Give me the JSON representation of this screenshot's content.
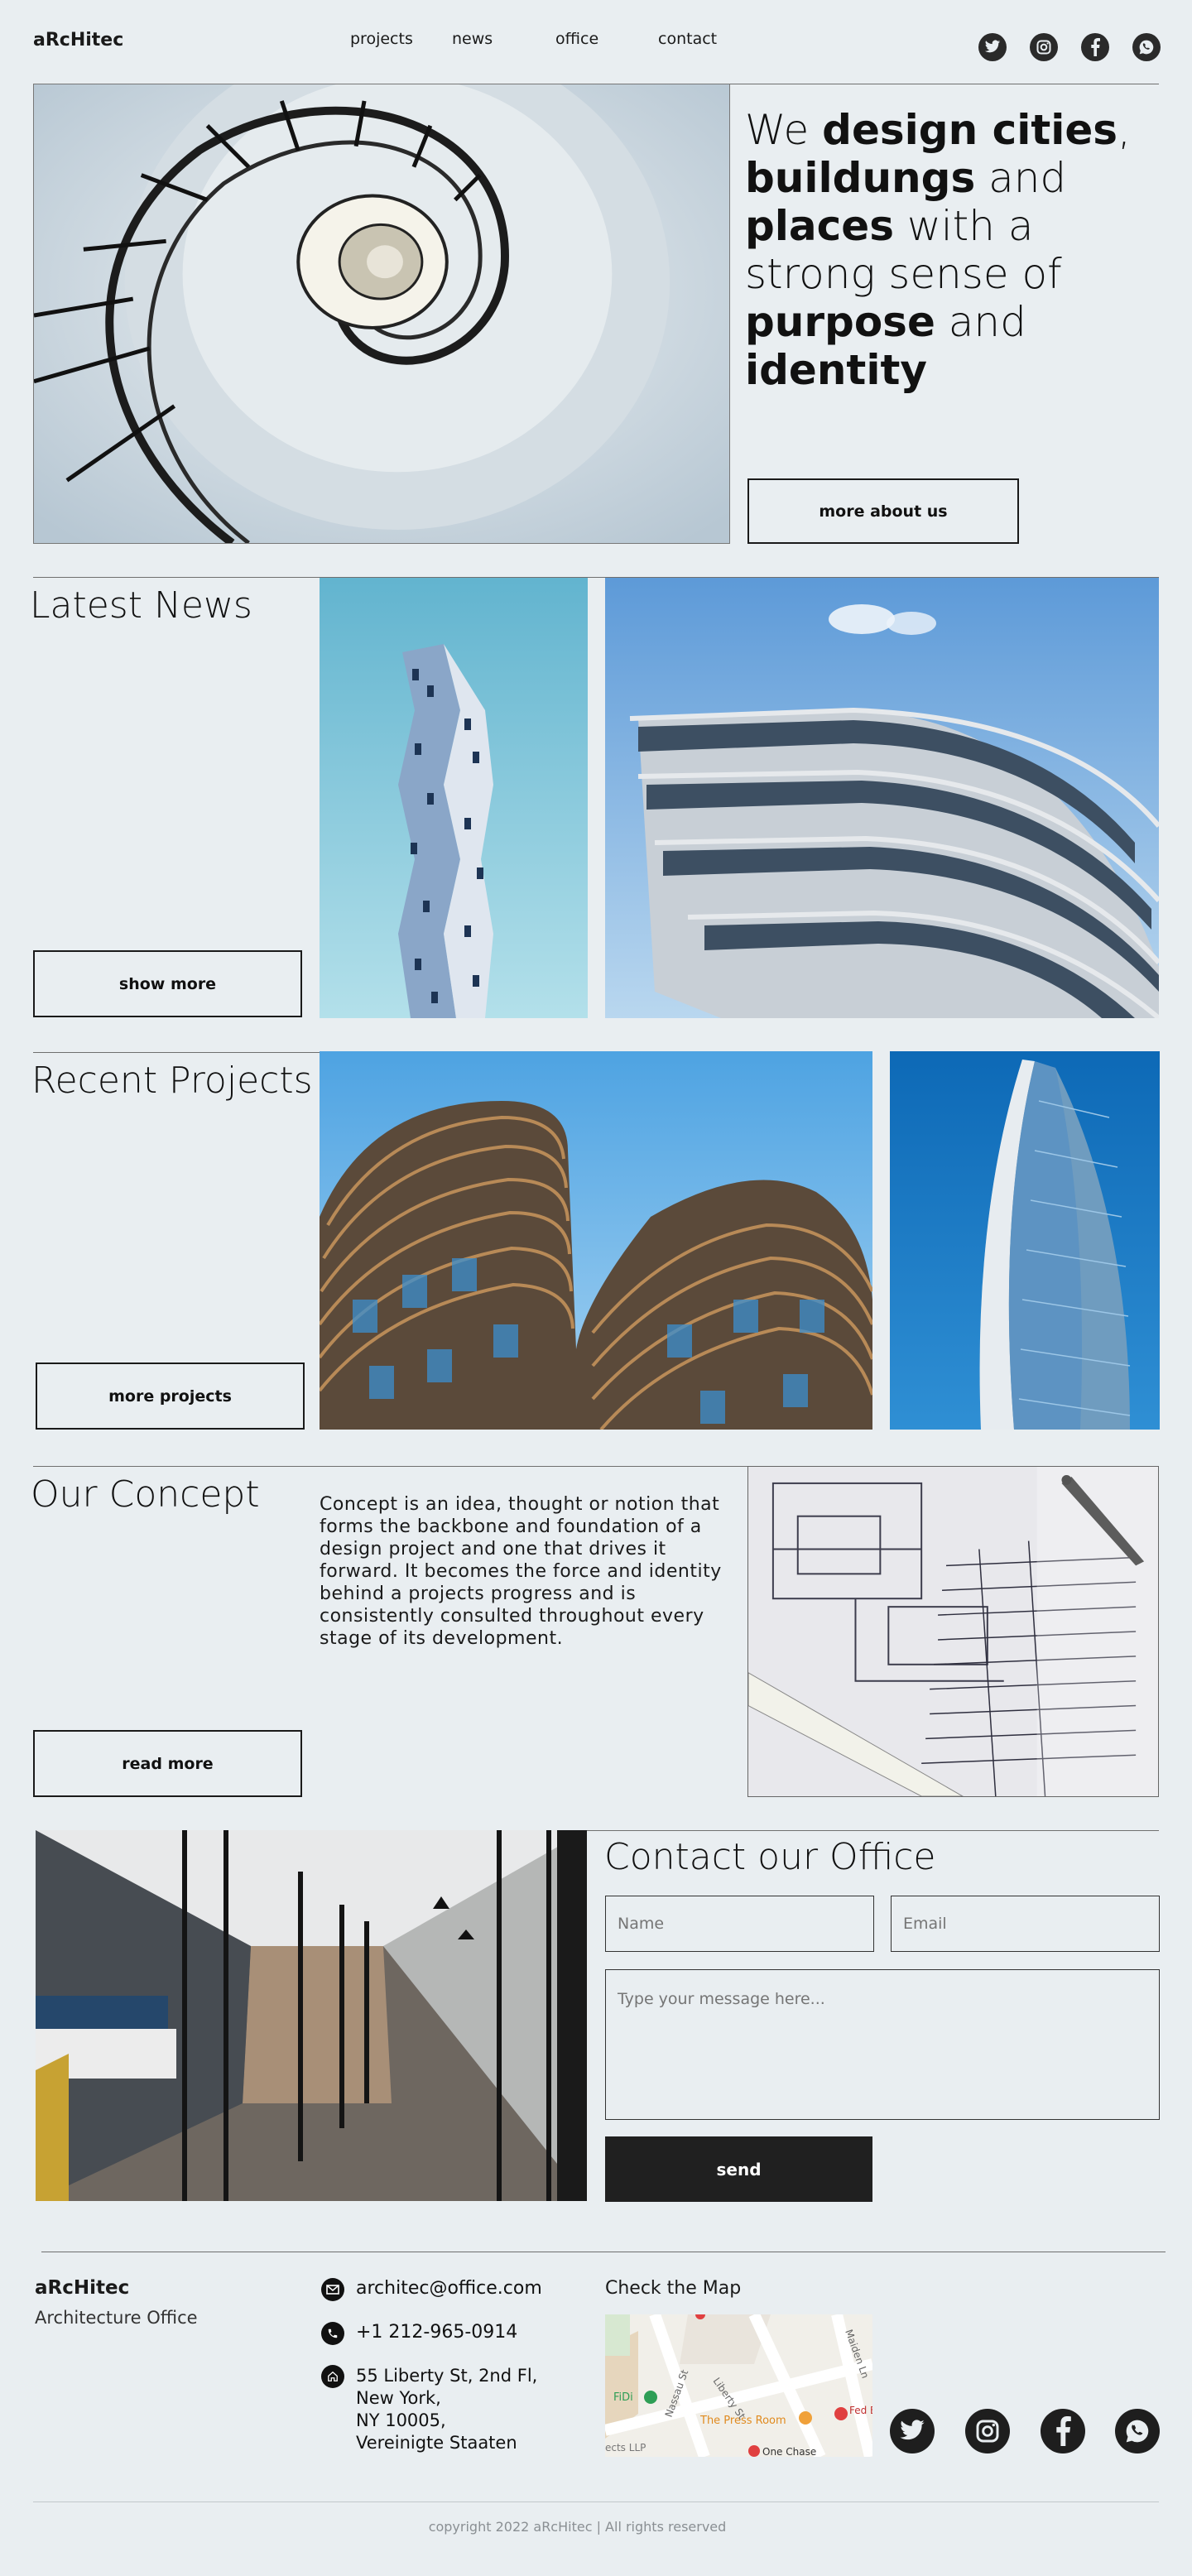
{
  "brand": {
    "logo": "aRcHitec"
  },
  "nav": {
    "items": [
      "projects",
      "news",
      "office",
      "contact"
    ]
  },
  "social": {
    "icons": [
      "twitter-icon",
      "instagram-icon",
      "facebook-icon",
      "whatsapp-icon"
    ]
  },
  "hero": {
    "p1": "We ",
    "b1": "design cities",
    "p2": ", ",
    "b2": "buildungs",
    "p3": " and ",
    "b3": "places",
    "p4": " with a strong sense of ",
    "b4": "purpose",
    "p5": " and ",
    "b5": "identity",
    "button": "more about us"
  },
  "news": {
    "title": "Latest News",
    "button": "show more"
  },
  "projects": {
    "title": "Recent Projects",
    "button": "more projects"
  },
  "concept": {
    "title": "Our Concept",
    "text": "Concept is an idea, thought or notion that forms the backbone and foundation of a design project and one that drives it forward. It becomes the force and identity behind a projects progress and is consistently consulted throughout every stage of its development.",
    "button": "read more"
  },
  "contact": {
    "title": "Contact our Office",
    "name_placeholder": "Name",
    "email_placeholder": "Email",
    "message_placeholder": "Type your message here...",
    "send": "send"
  },
  "footer": {
    "brand": "aRcHitec",
    "subtitle": "Architecture Office",
    "email": "architec@office.com",
    "phone": "+1 212-965-0914",
    "address_line1": "55 Liberty St, 2nd Fl,",
    "address_line2": "New York,",
    "address_line3": "NY 10005,",
    "address_line4": "Vereinigte Staaten",
    "map_title": "Check the Map",
    "map_labels": [
      "The Press Room",
      "One Chase",
      "Liberty St",
      "Nassau St",
      "Maiden Ln",
      "FiDi",
      "Fed Bank",
      "ects LLP"
    ],
    "copyright": "copyright 2022 aRcHitec | All rights reserved"
  },
  "colors": {
    "background": "#e9eef1",
    "dark": "#1e1e1e",
    "sky": "#8ec9e8"
  }
}
